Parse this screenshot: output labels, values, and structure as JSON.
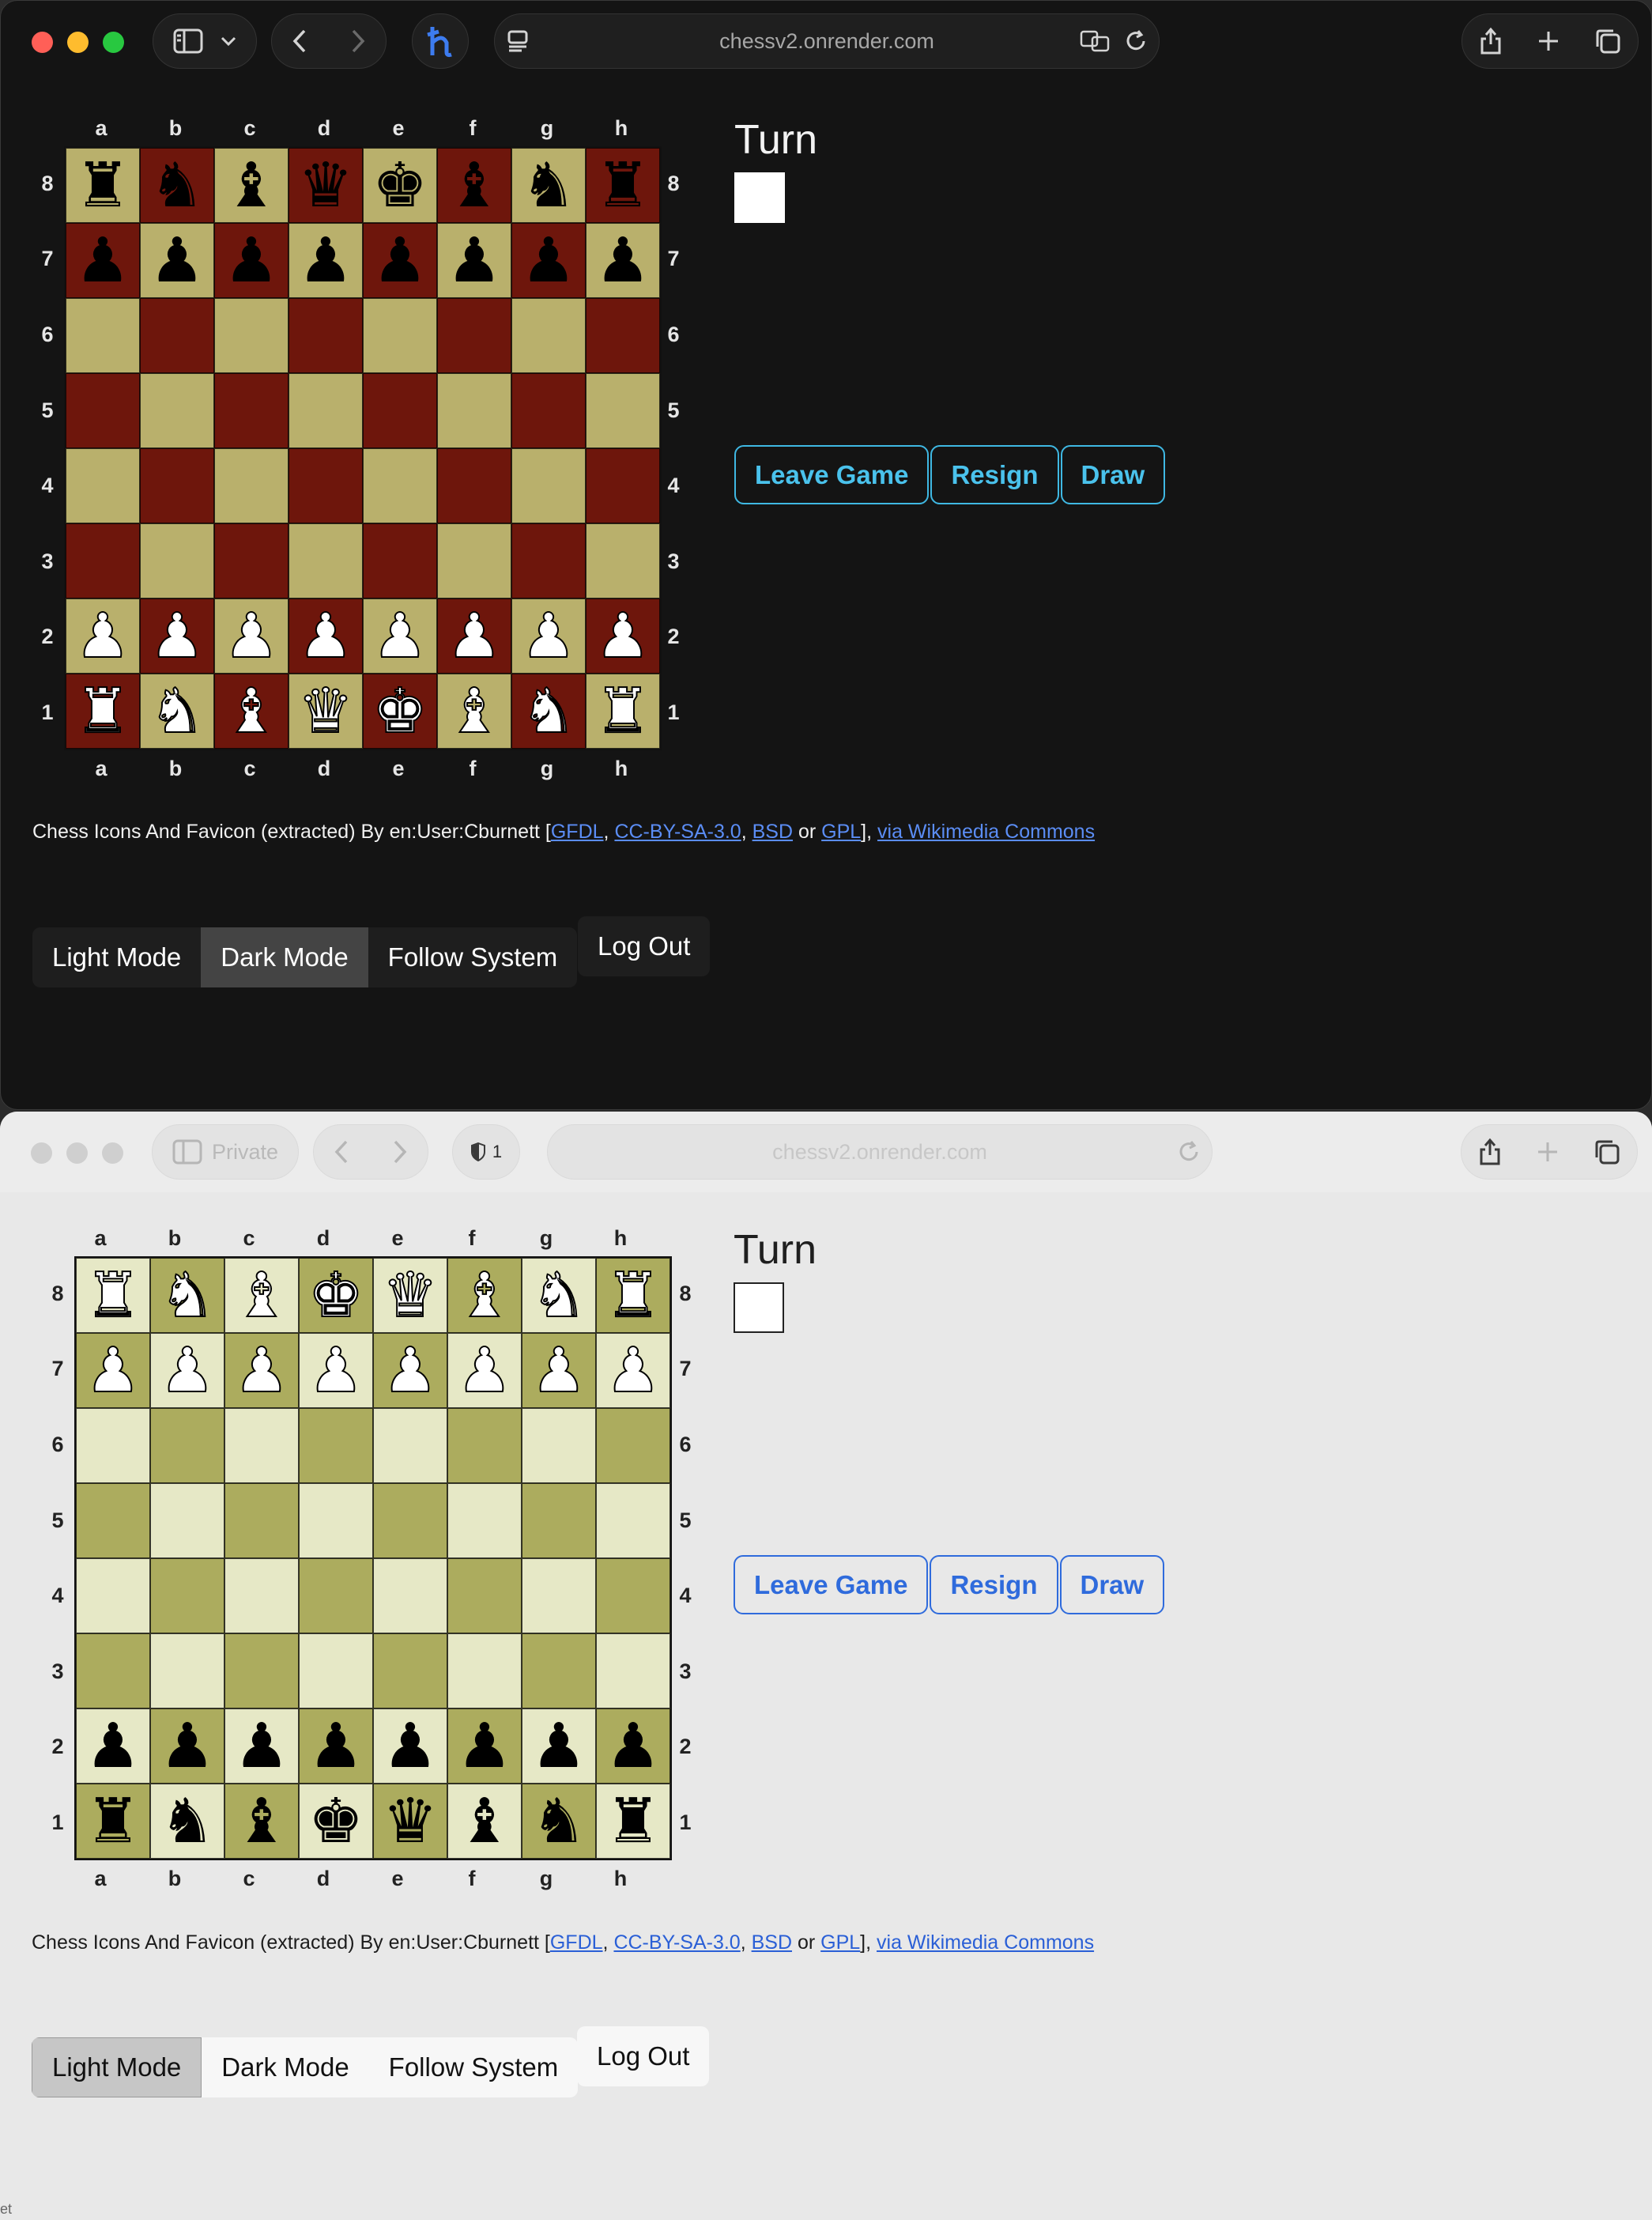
{
  "browser": {
    "url": "chessv2.onrender.com",
    "private_label": "Private",
    "shield_count": "1"
  },
  "board": {
    "files": [
      "a",
      "b",
      "c",
      "d",
      "e",
      "f",
      "g",
      "h"
    ],
    "ranks_dark": [
      "8",
      "7",
      "6",
      "5",
      "4",
      "3",
      "2",
      "1"
    ],
    "ranks_light": [
      "8",
      "7",
      "6",
      "5",
      "4",
      "3",
      "2",
      "1"
    ]
  },
  "dark_window": {
    "rows": [
      [
        "br",
        "bn",
        "bb",
        "bq",
        "bk",
        "bb",
        "bn",
        "br"
      ],
      [
        "bp",
        "bp",
        "bp",
        "bp",
        "bp",
        "bp",
        "bp",
        "bp"
      ],
      [
        "",
        "",
        "",
        "",
        "",
        "",
        "",
        ""
      ],
      [
        "",
        "",
        "",
        "",
        "",
        "",
        "",
        ""
      ],
      [
        "",
        "",
        "",
        "",
        "",
        "",
        "",
        ""
      ],
      [
        "",
        "",
        "",
        "",
        "",
        "",
        "",
        ""
      ],
      [
        "wp",
        "wp",
        "wp",
        "wp",
        "wp",
        "wp",
        "wp",
        "wp"
      ],
      [
        "wr",
        "wn",
        "wb",
        "wq",
        "wk",
        "wb",
        "wn",
        "wr"
      ]
    ]
  },
  "light_window": {
    "rows": [
      [
        "wr",
        "wn",
        "wb",
        "wk",
        "wq",
        "wb",
        "wn",
        "wr"
      ],
      [
        "wp",
        "wp",
        "wp",
        "wp",
        "wp",
        "wp",
        "wp",
        "wp"
      ],
      [
        "",
        "",
        "",
        "",
        "",
        "",
        "",
        ""
      ],
      [
        "",
        "",
        "",
        "",
        "",
        "",
        "",
        ""
      ],
      [
        "",
        "",
        "",
        "",
        "",
        "",
        "",
        ""
      ],
      [
        "",
        "",
        "",
        "",
        "",
        "",
        "",
        ""
      ],
      [
        "bp",
        "bp",
        "bp",
        "bp",
        "bp",
        "bp",
        "bp",
        "bp"
      ],
      [
        "br",
        "bn",
        "bb",
        "bk",
        "bq",
        "bb",
        "bn",
        "br"
      ]
    ]
  },
  "panel": {
    "turn_label": "Turn",
    "turn_color": "white",
    "leave_label": "Leave Game",
    "resign_label": "Resign",
    "draw_label": "Draw"
  },
  "credits": {
    "prefix": "Chess Icons And Favicon (extracted) By en:User:Cburnett [",
    "gfdl": "GFDL",
    "sep1": ", ",
    "ccbysa": "CC-BY-SA-3.0",
    "sep2": ", ",
    "bsd": "BSD",
    "or": " or ",
    "gpl": "GPL",
    "close": "], ",
    "wikimedia": "via Wikimedia Commons"
  },
  "modes": {
    "light": "Light Mode",
    "dark": "Dark Mode",
    "system": "Follow System",
    "logout": "Log Out",
    "dark_window_active": "dark",
    "light_window_active": "light"
  },
  "colors": {
    "dark_light_square": "#b9b06c",
    "dark_dark_square": "#6e160c",
    "light_light_square": "#e6e8c6",
    "light_dark_square": "#acac5e",
    "dark_accent": "#4ac2ec",
    "light_accent": "#2f6bdc"
  },
  "piece_glyphs": {
    "k": "♚",
    "q": "♛",
    "r": "♜",
    "b": "♝",
    "n": "♞",
    "p": "♟"
  },
  "edge_text": "et"
}
